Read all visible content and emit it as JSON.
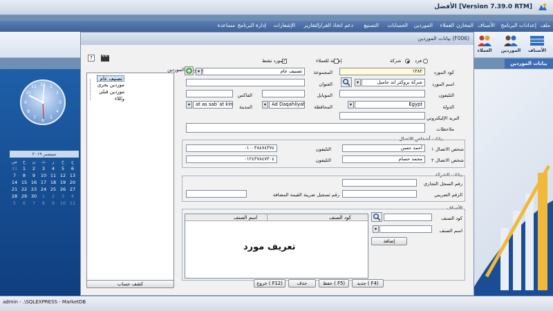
{
  "app": {
    "title": "الأفضل [Version 7.39.0 RTM]"
  },
  "menu": [
    "ملف",
    "إعدادات البرنامج",
    "الأصناف",
    "المخازن",
    "العملاء",
    "الموردين",
    "الحسابات",
    "التصنيع",
    "دعم اتخاذ القرار",
    "التقارير",
    "الإشعارات",
    "إدارة البرنامج",
    "مساعدة"
  ],
  "ribbon": {
    "items": [
      "الأصناف",
      "الموردين",
      "العملاء"
    ]
  },
  "nav_tab": "بيانات الموردين",
  "calendar": {
    "header": "سبتمبر ٢٠١٩",
    "weekdays": [
      "س",
      "ح",
      "ن",
      "ث",
      "ر",
      "خ",
      "ج"
    ],
    "rows": [
      [
        "31",
        "1",
        "2",
        "3",
        "4",
        "5",
        "6"
      ],
      [
        "7",
        "8",
        "9",
        "10",
        "11",
        "12",
        "13"
      ],
      [
        "14",
        "15",
        "16",
        "17",
        "18",
        "19",
        "20"
      ],
      [
        "21",
        "22",
        "23",
        "24",
        "25",
        "26",
        "27"
      ],
      [
        "28",
        "29",
        "30",
        "1",
        "2",
        "3",
        "4"
      ],
      [
        "5",
        "6",
        "7",
        "8",
        "9",
        "10",
        "11"
      ]
    ]
  },
  "status": {
    "text": "admin  -  .\\SQLEXPRESS  -  MarketDB"
  },
  "dialog": {
    "title": "بيانات الموردين (F006)",
    "help": "?",
    "type_individual": "فرد",
    "type_company": "شركة",
    "add_to_customers": "إضافة للعملاء",
    "active_supplier": "مورد نشط",
    "groups_header": "مجموعات الموردين",
    "tree": [
      "تصنيف عام",
      "موردين بحري",
      "موردين قبلي",
      "وكلاء"
    ],
    "account_statement": "كشف حساب",
    "labels": {
      "code": "كود المورد",
      "name": "اسم المورد",
      "phone": "التليفون",
      "country": "الدولة",
      "email": "البريد الإليكتروني",
      "notes": "ملاحظات",
      "group": "المجموعة",
      "address": "العنوان",
      "mobile": "الموبايل",
      "fax": "الفاكس",
      "governorate": "المحافظة",
      "city": "المدينة"
    },
    "values": {
      "code": "١٣٨٢",
      "name": "شركة بروكتر اند جامبل",
      "country": "Egypt",
      "group": "تصنيف عام",
      "governorate": "Ad Daqahliyah",
      "city": "at as sab`at kiman"
    },
    "contacts": {
      "title": "بيانات أشخاص الاتصال",
      "label1": "شخص الاتصال ١",
      "label2": "شخص الاتصال ٢",
      "phone_label": "التليفون",
      "name1": "أحمد حسن",
      "name2": "محمد حسام",
      "phone1": "٠١٠٠٣٨٤٧٤٣٧٤",
      "phone2": "٠١٢٤٣٧٨٤٧٣٠٤"
    },
    "company": {
      "title": "بيانات الشركة",
      "commercial_register": "رقم السجل التجاري",
      "tax_number": "الرقم الضريبي",
      "vat_number": "رقم تسجيل ضريبة القيمة المضافة"
    },
    "items": {
      "title": "الأصناف",
      "code_label": "كود الصنف",
      "name_label": "اسم الصنف",
      "add_button": "إضافة",
      "col_code": "كود الصنف",
      "col_name": "اسم الصنف",
      "watermark": "تعريف مورد"
    },
    "buttons": {
      "new": "جديد ( F4)",
      "save": "حفظ ( F5)",
      "delete": "حذف",
      "exit": "خروج ( F12)"
    }
  }
}
